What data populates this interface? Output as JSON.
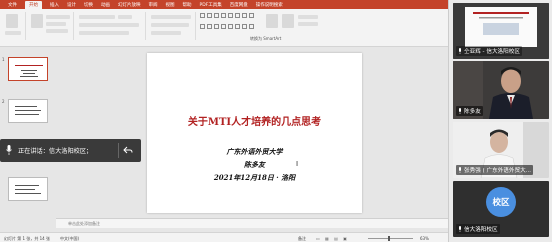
{
  "ribbon": {
    "tabs": [
      "文件",
      "开始",
      "插入",
      "设计",
      "切换",
      "动画",
      "幻灯片放映",
      "审阅",
      "视图",
      "帮助",
      "PDF工具集",
      "百度网盘",
      "操作说明搜索"
    ],
    "active_tab": "开始",
    "smartart_label": "转换为 SmartArt"
  },
  "thumbnails": {
    "numbers": [
      "1",
      "2"
    ]
  },
  "slide": {
    "title": "关于MTI人才培养的几点思考",
    "org": "广东外语外贸大学",
    "author": "陈多友",
    "date": "2021年12月18日 · 洛阳"
  },
  "notes": {
    "placeholder": "单击此处添加备注"
  },
  "status": {
    "page": "幻灯片 第 1 张，共 14 张",
    "lang": "中文(中国)",
    "notes_label": "备注",
    "zoom": "63%"
  },
  "toast": {
    "speaking": "正在讲话：信大洛阳校区；"
  },
  "participants": [
    {
      "name": "仝亚辉 - 信大洛阳校区"
    },
    {
      "name": "陈多友"
    },
    {
      "name": "张秀强 ( 广东外语外贸大..."
    },
    {
      "name": "信大洛阳校区",
      "avatar_text": "校区"
    }
  ],
  "colors": {
    "accent": "#c4432a",
    "title": "#b22222",
    "avatar": "#4a8fe0"
  }
}
